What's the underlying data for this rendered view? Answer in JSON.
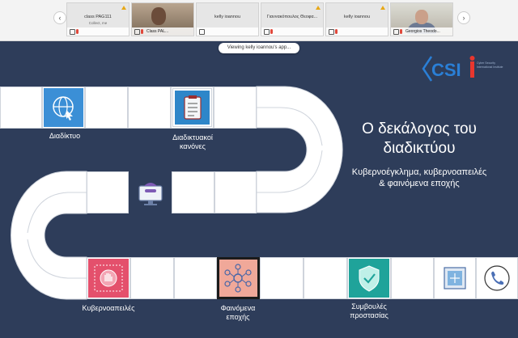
{
  "meeting": {
    "participants": [
      {
        "name": "class PAG111",
        "subtitle": "Collect, me",
        "bar_label": ""
      },
      {
        "name": "",
        "subtitle": "",
        "bar_label": "Class PAL..."
      },
      {
        "name": "kelly ioannou",
        "subtitle": "",
        "bar_label": ""
      },
      {
        "name": "Γιαννακόπουλος Θεοφα...",
        "subtitle": "",
        "bar_label": ""
      },
      {
        "name": "kelly ioannou",
        "subtitle": "",
        "bar_label": ""
      },
      {
        "name": "",
        "subtitle": "",
        "bar_label": "Georgios Theodo..."
      }
    ],
    "viewing_banner": "Viewing kelly ioannou's app..."
  },
  "slide": {
    "title_line1": "Ο δεκάλογος του",
    "title_line2": "διαδικτύου",
    "subtitle_line1": "Κυβερνοέγκλημα, κυβερνοαπειλές",
    "subtitle_line2": "& φαινόμενα εποχής",
    "logo_text": "CSI",
    "logo_sub": "Cyber Security International Institute",
    "labels": {
      "internet": "Διαδίκτυο",
      "rules_line1": "Διαδικτυακοί",
      "rules_line2": "κανόνες",
      "threats": "Κυβερνοαπειλές",
      "phenomena_line1": "Φαινόμενα",
      "phenomena_line2": "εποχής",
      "advice_line1": "Συμβουλές",
      "advice_line2": "προστασίας"
    },
    "colors": {
      "background": "#2e3d5a",
      "internet_icon": "#3b8fd6",
      "rules_icon": "#2e86c9",
      "threats_icon": "#e4506c",
      "phenomena_icon": "#f0a899",
      "advice_icon": "#1fa39a",
      "logo": "#2a7fd6"
    }
  }
}
